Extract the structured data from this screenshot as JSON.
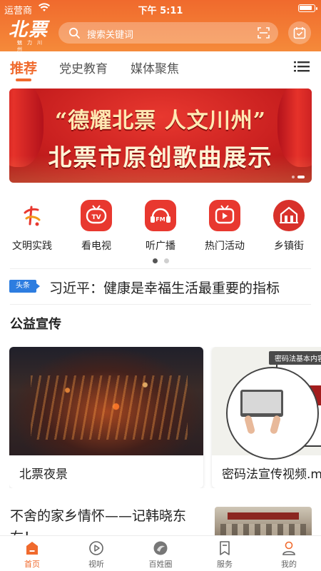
{
  "status_bar": {
    "carrier": "运营商",
    "time": "下午 5:11",
    "battery_level": 0.9
  },
  "header": {
    "logo_text": "北票",
    "logo_subtext": "魅力川州",
    "search_placeholder": "搜索关键词",
    "colors": {
      "accent": "#f06a2d",
      "accent_light": "#f58a3a"
    }
  },
  "tabs": [
    {
      "label": "推荐",
      "active": true
    },
    {
      "label": "党史教育",
      "active": false
    },
    {
      "label": "媒体聚焦",
      "active": false
    }
  ],
  "banner": {
    "line1": "“德耀北票 人文川州”",
    "line2": "北票市原创歌曲展示",
    "slide_count": 2,
    "current_slide": 1
  },
  "quick_links": [
    {
      "label": "文明实践",
      "icon": "civilization-practice-icon",
      "color": "#e8382f"
    },
    {
      "label": "看电视",
      "icon": "tv-icon",
      "color": "#e8382f"
    },
    {
      "label": "听广播",
      "icon": "fm-radio-icon",
      "color": "#e8382f"
    },
    {
      "label": "热门活动",
      "icon": "hot-activity-icon",
      "color": "#e8382f"
    },
    {
      "label": "乡镇街",
      "icon": "township-icon",
      "color": "#d8312a"
    }
  ],
  "quick_links_pages": {
    "count": 2,
    "current": 1
  },
  "headline": {
    "badge": "头条",
    "text": "习近平：健康是幸福生活最重要的指标"
  },
  "section": {
    "title": "公益宣传",
    "cards": [
      {
        "title": "北票夜景",
        "thumb": "night-city-thumbnail"
      },
      {
        "title": "密码法宣传视频.m",
        "thumb": "crypto-law-thumbnail",
        "thumb_tag": "密码法基本内容"
      }
    ]
  },
  "article": {
    "title": "不舍的家乡情怀——记韩晓东",
    "title_cont": "右！",
    "thumb": "building-thumbnail"
  },
  "bottom_nav": [
    {
      "label": "首页",
      "icon": "home-icon",
      "active": true
    },
    {
      "label": "视听",
      "icon": "play-icon",
      "active": false
    },
    {
      "label": "百姓圈",
      "icon": "community-icon",
      "active": false
    },
    {
      "label": "服务",
      "icon": "bookmark-icon",
      "active": false
    },
    {
      "label": "我的",
      "icon": "profile-icon",
      "active": false
    }
  ]
}
